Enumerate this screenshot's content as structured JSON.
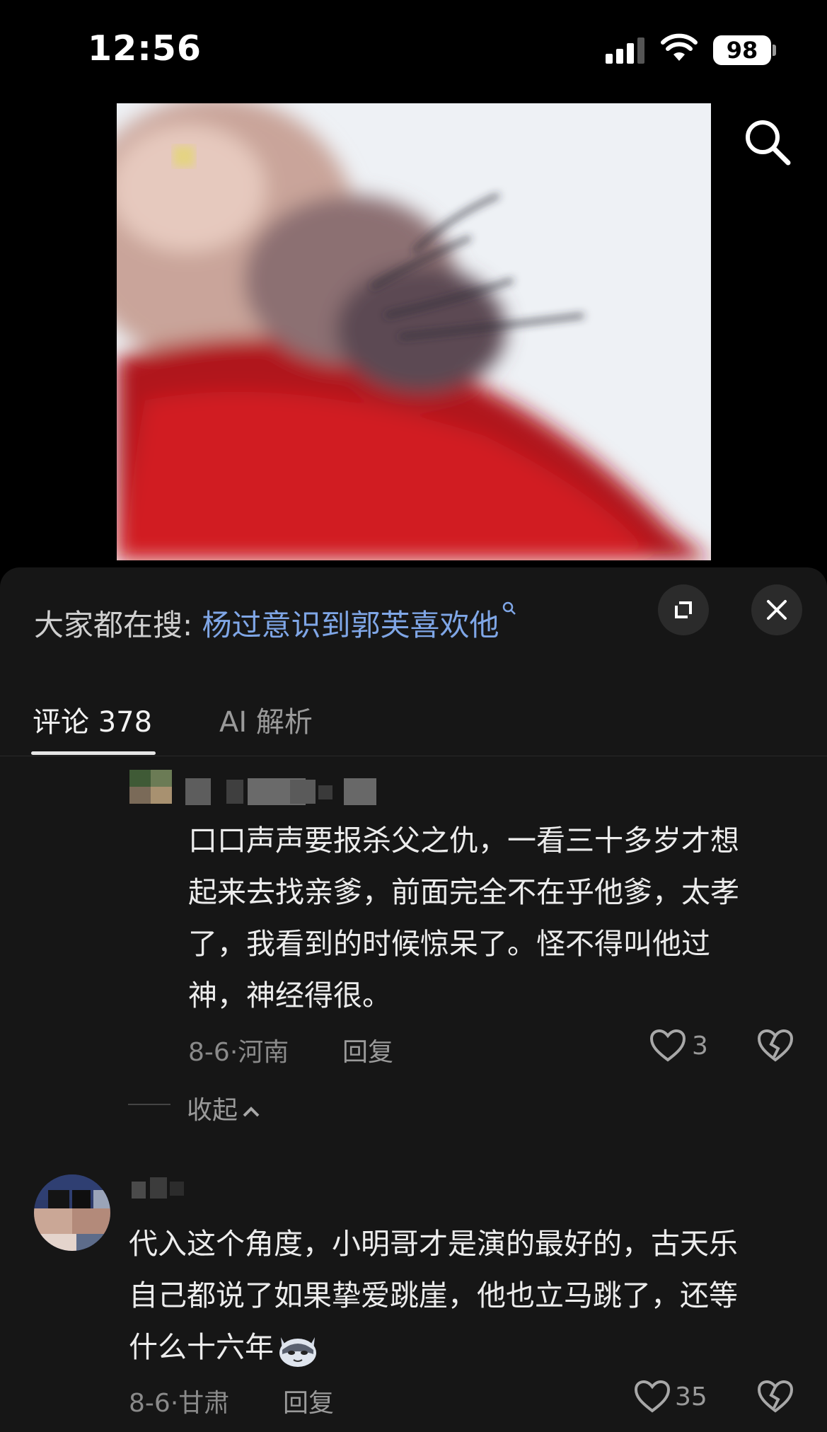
{
  "status": {
    "time": "12:56",
    "battery": "98"
  },
  "trending": {
    "prefix": "大家都在搜: ",
    "query": "杨过意识到郭芙喜欢他"
  },
  "tabs": [
    {
      "label": "评论 378"
    },
    {
      "label": "AI 解析"
    }
  ],
  "comments": [
    {
      "text_lines": [
        "口口声声要报杀父之仇，一看三十多岁才想",
        "起来去找亲爹，前面完全不在乎他爹，太孝",
        "了，我看到的时候惊呆了。怪不得叫他过",
        "神，神经得很。"
      ],
      "date": "8-6",
      "location": "河南",
      "reply_label": "回复",
      "likes": "3"
    },
    {
      "text_lines": [
        "代入这个角度，小明哥才是演的最好的，古天乐",
        "自己都说了如果挚爱跳崖，他也立马跳了，还等",
        "什么十六年"
      ],
      "date": "8-6",
      "location": "甘肃",
      "reply_label": "回复",
      "likes": "35"
    }
  ],
  "collapse_label": "收起",
  "icons": [
    "signal-icon",
    "wifi-icon",
    "search-icon",
    "expand-icon",
    "close-icon",
    "heart-icon",
    "broken-heart-icon",
    "chevron-up-icon",
    "sticker-icon"
  ]
}
